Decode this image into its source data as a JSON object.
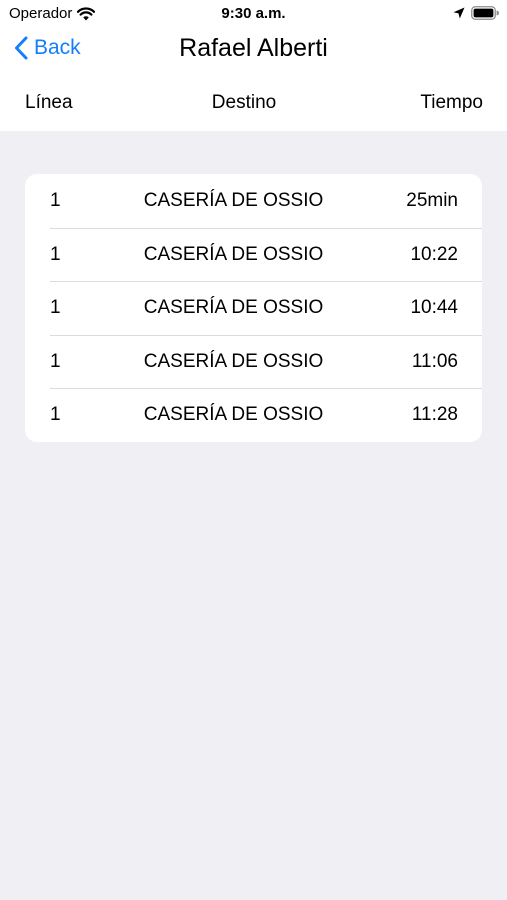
{
  "status_bar": {
    "carrier": "Operador",
    "time": "9:30 a.m.",
    "icons": [
      "wifi-icon",
      "location-arrow-icon",
      "battery-icon"
    ]
  },
  "nav": {
    "back_label": "Back",
    "title": "Rafael Alberti",
    "accent_color": "#147efb"
  },
  "columns": {
    "line": "Línea",
    "destination": "Destino",
    "time": "Tiempo"
  },
  "rows": [
    {
      "line": "1",
      "destination": "CASERÍA DE OSSIO",
      "time": "25min"
    },
    {
      "line": "1",
      "destination": "CASERÍA DE OSSIO",
      "time": "10:22"
    },
    {
      "line": "1",
      "destination": "CASERÍA DE OSSIO",
      "time": "10:44"
    },
    {
      "line": "1",
      "destination": "CASERÍA DE OSSIO",
      "time": "11:06"
    },
    {
      "line": "1",
      "destination": "CASERÍA DE OSSIO",
      "time": "11:28"
    }
  ]
}
